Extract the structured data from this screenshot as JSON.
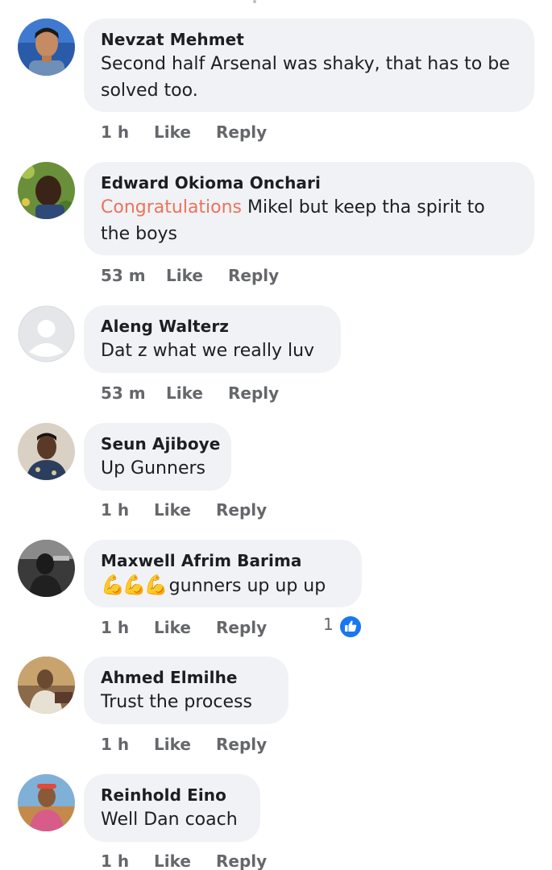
{
  "colors": {
    "bubble": "#f0f2f5",
    "meta_text": "#65676b",
    "mention": "#e9745b",
    "like_blue": "#1877f2"
  },
  "comments": [
    {
      "author": "Nevzat Mehmet",
      "text_line1": "Second half Arsenal was shaky, that has to be",
      "text_line2": "solved too.",
      "time": "1 h",
      "like": "Like",
      "reply": "Reply",
      "avatar_icon": "profile-photo"
    },
    {
      "author": "Edward Okioma Onchari",
      "mention": "Congratulations",
      "text_line1_rest": " Mikel but keep tha spirit to",
      "text_line2": "the boys",
      "time": "53 m",
      "like": "Like",
      "reply": "Reply",
      "avatar_icon": "profile-photo"
    },
    {
      "author": "Aleng Walterz",
      "text": "Dat z what we really luv",
      "time": "53 m",
      "like": "Like",
      "reply": "Reply",
      "avatar_icon": "default-avatar-icon"
    },
    {
      "author": "Seun Ajiboye",
      "text": "Up Gunners",
      "time": "1 h",
      "like": "Like",
      "reply": "Reply",
      "avatar_icon": "profile-photo"
    },
    {
      "author": "Maxwell Afrim Barima",
      "emoji": "💪💪💪",
      "text": "gunners up up up",
      "time": "1 h",
      "like": "Like",
      "reply": "Reply",
      "reaction_count": "1",
      "reaction_icon": "thumbs-up-icon",
      "avatar_icon": "profile-photo"
    },
    {
      "author": "Ahmed Elmilhe",
      "text": "Trust the process",
      "time": "1 h",
      "like": "Like",
      "reply": "Reply",
      "avatar_icon": "profile-photo"
    },
    {
      "author": "Reinhold Eino",
      "text": "Well Dan coach",
      "time": "1 h",
      "like": "Like",
      "reply": "Reply",
      "avatar_icon": "profile-photo"
    }
  ]
}
